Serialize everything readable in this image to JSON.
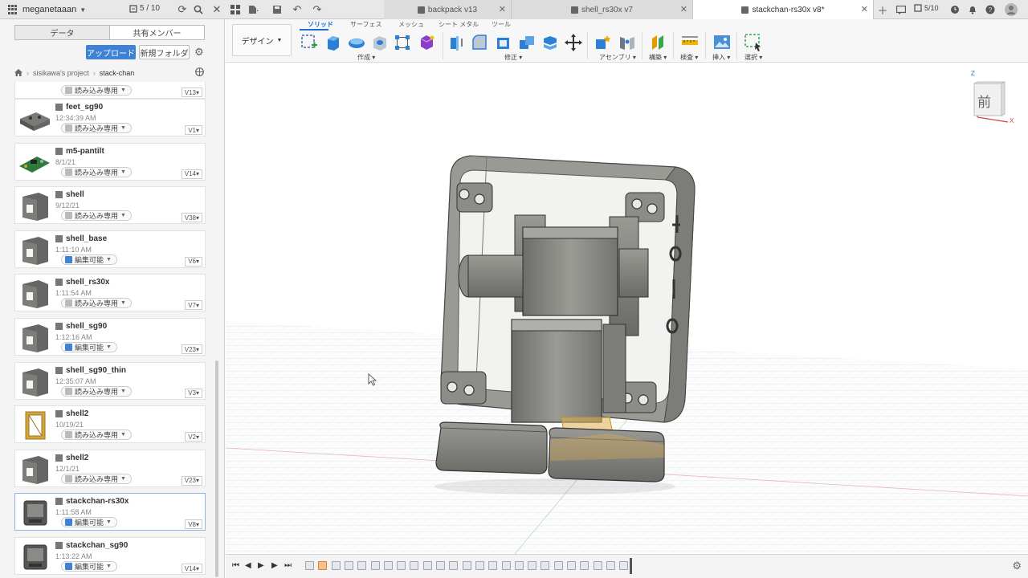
{
  "topbar": {
    "user_name": "meganetaaan",
    "jobs_count": "5 / 10",
    "tabs": [
      {
        "label": "backpack v13"
      },
      {
        "label": "shell_rs30x v7"
      },
      {
        "label": "stackchan-rs30x v8*"
      }
    ],
    "right_jobs": "5/10"
  },
  "panel": {
    "seg_data": "データ",
    "seg_members": "共有メンバー",
    "upload_label": "アップロード",
    "new_folder_label": "新規フォルダ",
    "breadcrumb_project": "sisikawa's project",
    "breadcrumb_folder": "stack-chan",
    "top_partial_version": "V13",
    "top_partial_status": "読み込み専用",
    "items": [
      {
        "name": "feet_sg90",
        "date": "12:34:39 AM",
        "status": "読み込み専用",
        "version": "V1"
      },
      {
        "name": "m5-pantilt",
        "date": "8/1/21",
        "status": "読み込み専用",
        "version": "V14"
      },
      {
        "name": "shell",
        "date": "9/12/21",
        "status": "読み込み専用",
        "version": "V38"
      },
      {
        "name": "shell_base",
        "date": "1:11:10 AM",
        "status": "編集可能",
        "version": "V6"
      },
      {
        "name": "shell_rs30x",
        "date": "1:11:54 AM",
        "status": "読み込み専用",
        "version": "V7"
      },
      {
        "name": "shell_sg90",
        "date": "1:12:16 AM",
        "status": "編集可能",
        "version": "V23"
      },
      {
        "name": "shell_sg90_thin",
        "date": "12:35:07 AM",
        "status": "読み込み専用",
        "version": "V3"
      },
      {
        "name": "shell2",
        "date": "10/19/21",
        "status": "読み込み専用",
        "version": "V2"
      },
      {
        "name": "shell2",
        "date": "12/1/21",
        "status": "読み込み専用",
        "version": "V23"
      },
      {
        "name": "stackchan-rs30x",
        "date": "1:11:58 AM",
        "status": "編集可能",
        "version": "V8"
      },
      {
        "name": "stackchan_sg90",
        "date": "1:13:22 AM",
        "status": "編集可能",
        "version": "V14"
      }
    ]
  },
  "toolbar": {
    "workspace": "デザイン",
    "tabs": [
      "ソリッド",
      "サーフェス",
      "メッシュ",
      "シート メタル",
      "ツール"
    ],
    "groups": [
      "作成",
      "修正",
      "アセンブリ",
      "構築",
      "検査",
      "挿入",
      "選択"
    ]
  },
  "viewcube": {
    "face_label": "前",
    "axis_z": "Z",
    "axis_x": "X"
  },
  "colors": {
    "accent": "#1c6fd1",
    "upload": "#3f82d3",
    "model_gray": "#8a8a86",
    "highlight": "#e0b050"
  }
}
